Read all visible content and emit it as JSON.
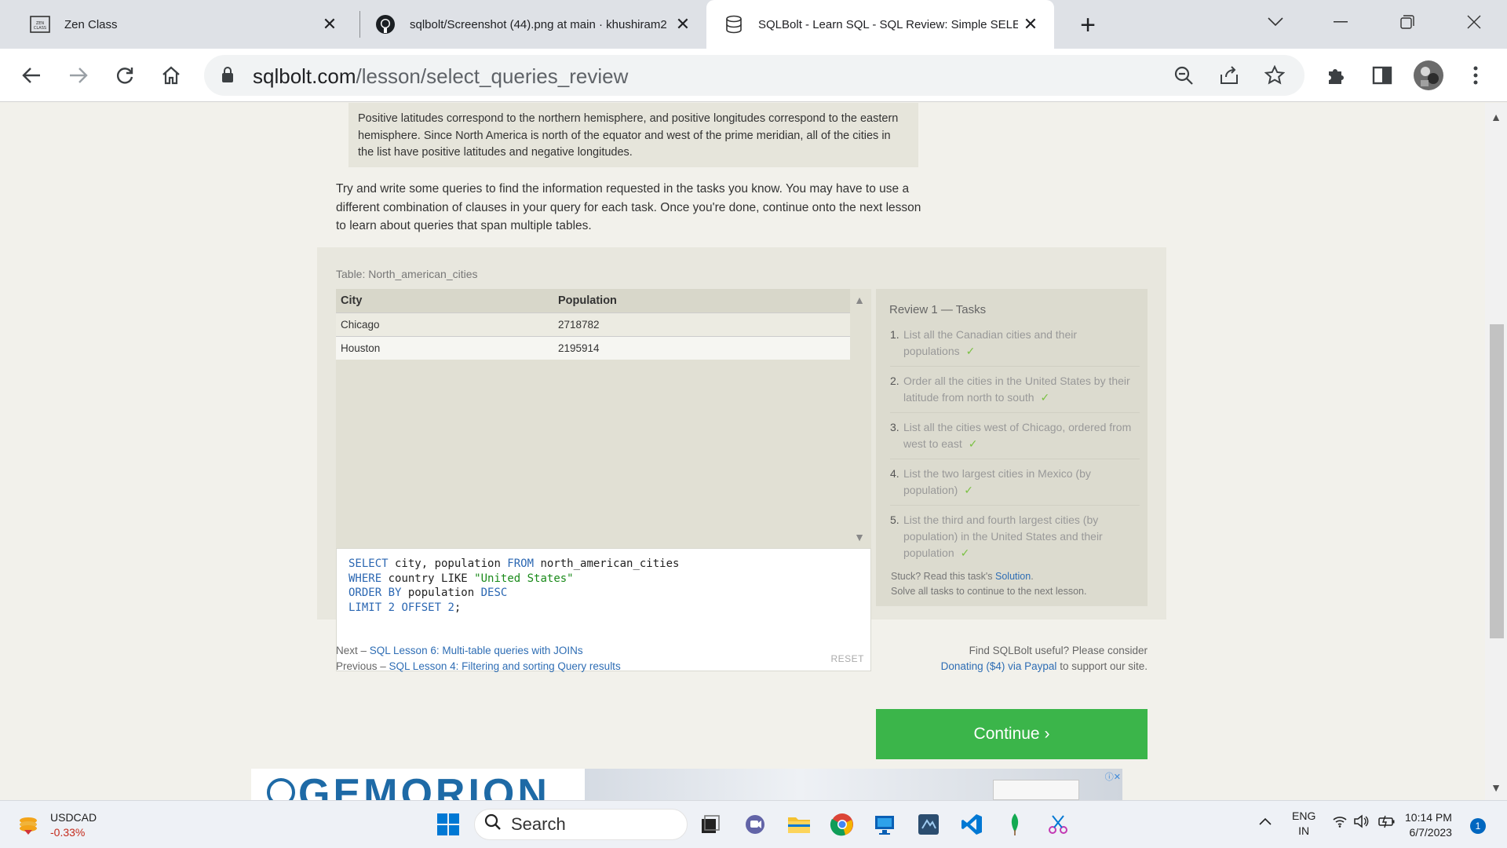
{
  "tabs": [
    {
      "title": "Zen Class",
      "icon": "zen-class-icon"
    },
    {
      "title": "sqlbolt/Screenshot (44).png at main · khushiram2",
      "icon": "github-icon"
    },
    {
      "title": "SQLBolt - Learn SQL - SQL Review: Simple SELECT",
      "icon": "database-icon"
    }
  ],
  "address": {
    "host": "sqlbolt.com",
    "path": "/lesson/select_queries_review"
  },
  "lesson": {
    "note": "Positive latitudes correspond to the northern hemisphere, and positive longitudes correspond to the eastern hemisphere. Since North America is north of the equator and west of the prime meridian, all of the cities in the list have positive latitudes and negative longitudes.",
    "intro": "Try and write some queries to find the information requested in the tasks you know. You may have to use a different combination of clauses in your query for each task. Once you're done, continue onto the next lesson to learn about queries that span multiple tables."
  },
  "exercise": {
    "table_caption": "Table: North_american_cities",
    "columns": [
      "City",
      "Population"
    ],
    "rows": [
      [
        "Chicago",
        "2718782"
      ],
      [
        "Houston",
        "2195914"
      ]
    ],
    "query": {
      "line1_kw1": "SELECT",
      "line1_a": " city, population ",
      "line1_kw2": "FROM",
      "line1_b": " north_american_cities",
      "line2_kw": "WHERE",
      "line2_a": " country LIKE ",
      "line2_str": "\"United States\"",
      "line3_kw": "ORDER BY",
      "line3_a": " population ",
      "line3_kw2": "DESC",
      "line4_kw": "LIMIT",
      "line4_num1": " 2 ",
      "line4_kw2": "OFFSET",
      "line4_num2": " 2",
      "line4_end": ";"
    },
    "reset_label": "RESET"
  },
  "tasks": {
    "title": "Review 1 — Tasks",
    "items": [
      {
        "n": "1.",
        "text": "List all the Canadian cities and their populations",
        "check": "✓"
      },
      {
        "n": "2.",
        "text": "Order all the cities in the United States by their latitude from north to south",
        "check": "✓"
      },
      {
        "n": "3.",
        "text": "List all the cities west of Chicago, ordered from west to east",
        "check": "✓"
      },
      {
        "n": "4.",
        "text": "List the two largest cities in Mexico (by population)",
        "check": "✓"
      },
      {
        "n": "5.",
        "text": "List the third and fourth largest cities (by population) in the United States and their population",
        "check": "✓"
      }
    ],
    "stuck_prefix": "Stuck? Read this task's ",
    "solution_link": "Solution",
    "stuck_suffix": ".",
    "solve_all": "Solve all tasks to continue to the next lesson.",
    "continue_label": "Continue ›"
  },
  "footer": {
    "next_prefix": "Next – ",
    "next_link": "SQL Lesson 6: Multi-table queries with JOINs",
    "prev_prefix": "Previous – ",
    "prev_link": "SQL Lesson 4: Filtering and sorting Query results",
    "useful": "Find SQLBolt useful? Please consider",
    "donate_link": "Donating ($4) via Paypal",
    "donate_suffix": " to support our site."
  },
  "ad": {
    "brand": "GEMORION"
  },
  "taskbar": {
    "ticker_symbol": "USDCAD",
    "ticker_change": "-0.33%",
    "search_label": "Search",
    "lang1": "ENG",
    "lang2": "IN",
    "time": "10:14 PM",
    "date": "6/7/2023",
    "notifications": "1"
  },
  "colors": {
    "continue": "#3bb54a",
    "link": "#2e6db4",
    "check": "#7ac142"
  }
}
